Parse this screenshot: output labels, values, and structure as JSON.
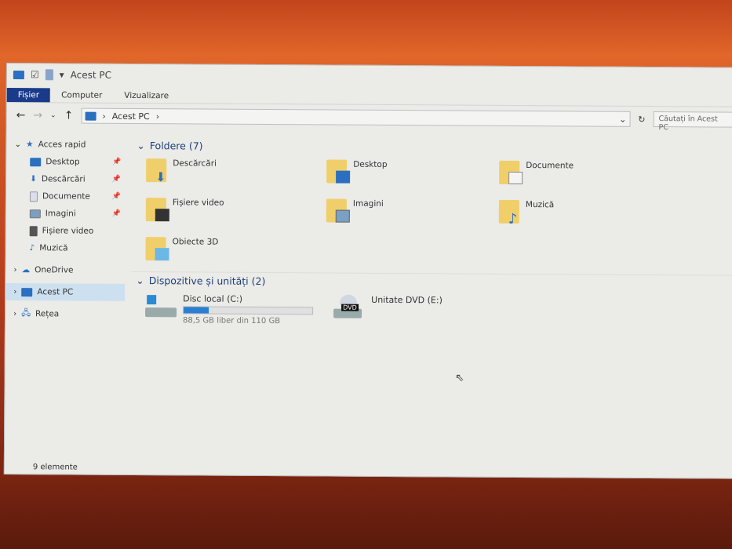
{
  "window": {
    "title": "Acest PC",
    "status": "9 elemente"
  },
  "ribbon": {
    "tabs": [
      "Fișier",
      "Computer",
      "Vizualizare"
    ]
  },
  "nav": {
    "path": "Acest PC",
    "search_placeholder": "Căutați în Acest PC"
  },
  "sidebar": {
    "quick_access": "Acces rapid",
    "pinned": [
      {
        "label": "Desktop",
        "pinned": true
      },
      {
        "label": "Descărcări",
        "pinned": true
      },
      {
        "label": "Documente",
        "pinned": true
      },
      {
        "label": "Imagini",
        "pinned": true
      },
      {
        "label": "Fișiere video",
        "pinned": false
      },
      {
        "label": "Muzică",
        "pinned": false
      }
    ],
    "onedrive": "OneDrive",
    "thispc": "Acest PC",
    "network": "Rețea"
  },
  "folders": {
    "header": "Foldere (7)",
    "items": [
      "Descărcări",
      "Desktop",
      "Documente",
      "Fișiere video",
      "Imagini",
      "Muzică",
      "Obiecte 3D"
    ]
  },
  "devices": {
    "header": "Dispozitive și unități (2)",
    "disk": {
      "label": "Disc local (C:)",
      "free": "88,5 GB liber din 110 GB",
      "used_fraction": 0.195
    },
    "dvd": {
      "label": "Unitate DVD (E:)",
      "badge": "DVD"
    }
  }
}
